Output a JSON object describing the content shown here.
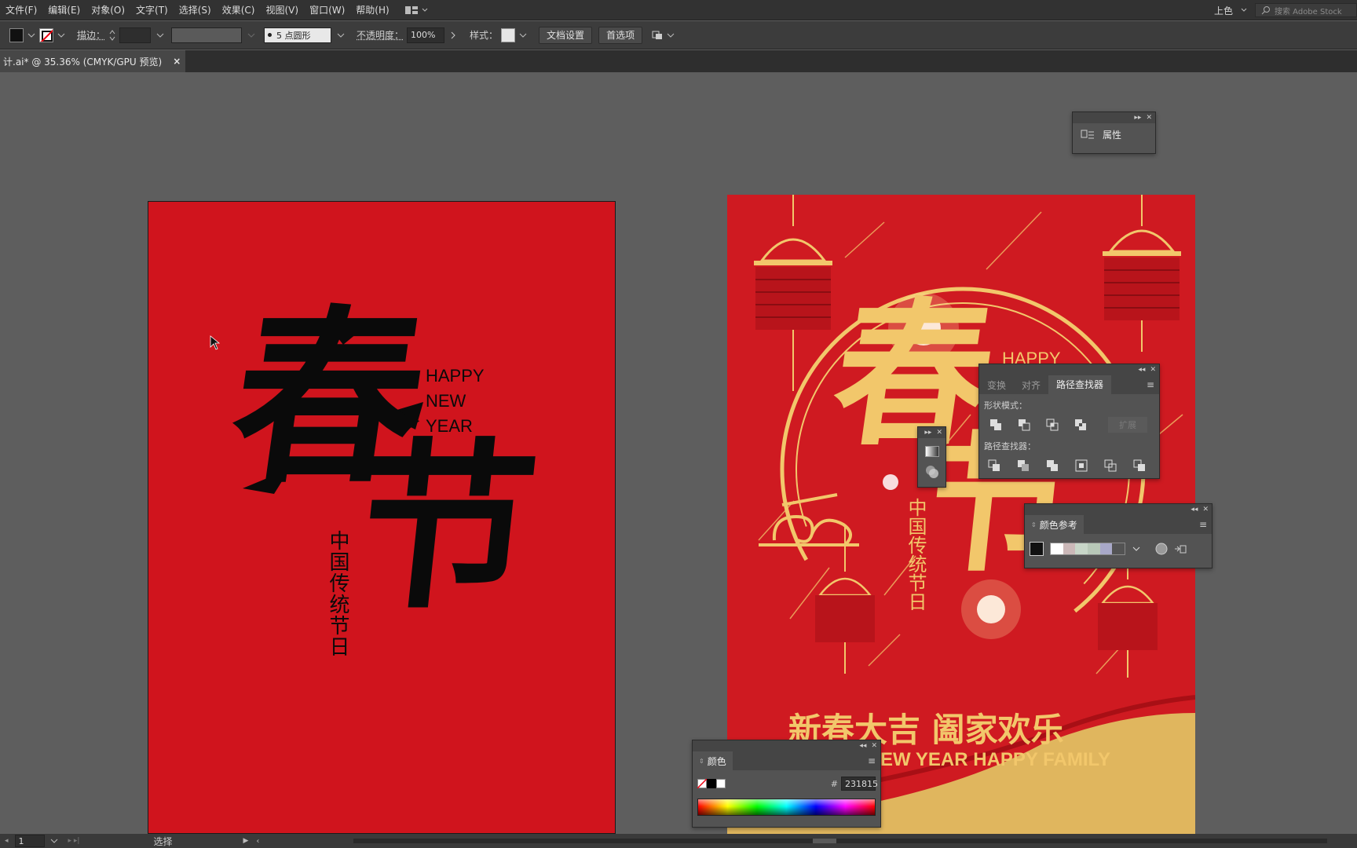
{
  "menu": [
    "文件(F)",
    "编辑(E)",
    "对象(O)",
    "文字(T)",
    "选择(S)",
    "效果(C)",
    "视图(V)",
    "窗口(W)",
    "帮助(H)"
  ],
  "workspace": {
    "label": "上色",
    "search_placeholder": "搜索 Adobe Stock"
  },
  "control": {
    "stroke_label": "描边：",
    "brush_label": "5 点圆形",
    "opacity_label": "不透明度：",
    "opacity_value": "100%",
    "style_label": "样式：",
    "doc_setup": "文档设置",
    "preferences": "首选项"
  },
  "document_tab": {
    "title": "计.ai* @ 35.36% (CMYK/GPU 预览)",
    "close": "×"
  },
  "artboard1": {
    "bg_color": "#d0141d",
    "big_chars": [
      "春",
      "节"
    ],
    "vertical_text": "中国传统节日",
    "happy_lines": [
      "HAPPY",
      "NEW",
      "YEAR"
    ]
  },
  "artboard2": {
    "bg_color": "#cf1a21",
    "accent": "#f2c76b",
    "big_chars": [
      "春",
      "节"
    ],
    "vertical_text": "中国传统节日",
    "happy": "HAPPY",
    "slogan": "新春大吉 阖家欢乐",
    "slogan_en": "EW YEAR HAPPY FAMILY"
  },
  "properties_panel": {
    "label": "属性"
  },
  "pathfinder_panel": {
    "tabs": [
      "变换",
      "对齐",
      "路径查找器"
    ],
    "shape_modes_label": "形状模式：",
    "expand_label": "扩展",
    "pathfinders_label": "路径查找器："
  },
  "color_guide_panel": {
    "title": "颜色参考"
  },
  "color_panel": {
    "title": "颜色",
    "hex_label": "#",
    "hex_value": "231815"
  },
  "status": {
    "page": "1",
    "tool": "选择"
  }
}
